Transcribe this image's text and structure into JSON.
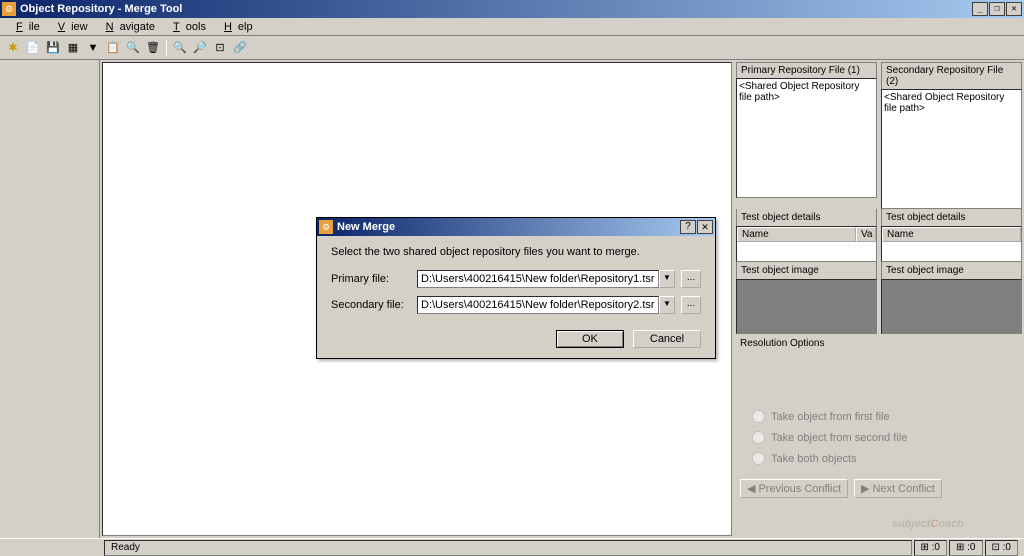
{
  "window": {
    "title": "Object Repository - Merge Tool",
    "buttons": {
      "min": "_",
      "restore": "❐",
      "close": "✕"
    }
  },
  "menu": {
    "file": "File",
    "view": "View",
    "navigate": "Navigate",
    "tools": "Tools",
    "help": "Help"
  },
  "toolbar_icons": [
    "✱",
    "📄",
    "💾",
    "▦",
    "🔽",
    "📋",
    "🔍",
    "🗑",
    "🔍",
    "🔍",
    "🔍",
    "🔗"
  ],
  "right_panel": {
    "primary_header": "Primary Repository File (1)",
    "secondary_header": "Secondary Repository File (2)",
    "primary_path": "<Shared Object Repository file path>",
    "secondary_path": "<Shared Object Repository file path>",
    "details_label": "Test object details",
    "col_name": "Name",
    "col_va": "Va",
    "image_label": "Test object image",
    "resolution_label": "Resolution Options",
    "opt1": "Take object from first file",
    "opt2": "Take object from second file",
    "opt3": "Take both objects",
    "prev_conflict": "Previous Conflict",
    "next_conflict": "Next Conflict"
  },
  "dialog": {
    "title": "New Merge",
    "help": "?",
    "close": "✕",
    "instruction": "Select the two shared object repository files you want to merge.",
    "primary_label": "Primary file:",
    "secondary_label": "Secondary file:",
    "primary_value": "D:\\Users\\400216415\\New folder\\Repository1.tsr",
    "secondary_value": "D:\\Users\\400216415\\New folder\\Repository2.tsr",
    "browse": "...",
    "ok": "OK",
    "cancel": "Cancel"
  },
  "status": {
    "ready": "Ready",
    "pane1": "⊞ :0",
    "pane2": "⊞ :0",
    "pane3": "⊡ :0"
  },
  "watermark": {
    "a": "subject",
    "b": "C",
    "c": "oach"
  }
}
